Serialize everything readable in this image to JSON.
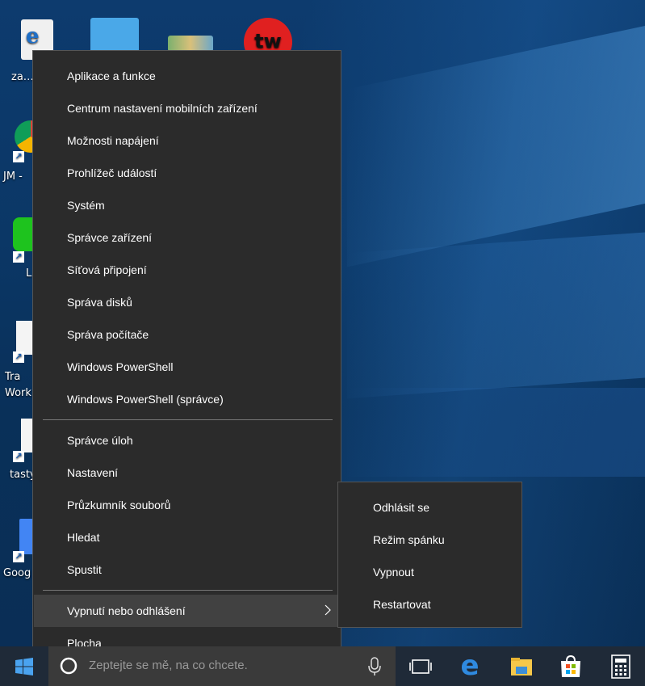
{
  "desktop": {
    "icons": [
      {
        "name": "doc-shortcut",
        "label": "za… stra…"
      },
      {
        "name": "chrome-shortcut",
        "label": "JM -"
      },
      {
        "name": "line-shortcut",
        "label": "L"
      },
      {
        "name": "pdf-shortcut",
        "label": "Tra Work"
      },
      {
        "name": "tasty-shortcut",
        "label": "tasty"
      },
      {
        "name": "google-docs-shortcut",
        "label": "Goog"
      }
    ]
  },
  "menu": {
    "items": [
      {
        "label": "Aplikace a funkce"
      },
      {
        "label": "Centrum nastavení mobilních zařízení"
      },
      {
        "label": "Možnosti napájení"
      },
      {
        "label": "Prohlížeč událostí"
      },
      {
        "label": "Systém"
      },
      {
        "label": "Správce zařízení"
      },
      {
        "label": "Síťová připojení"
      },
      {
        "label": "Správa disků"
      },
      {
        "label": "Správa počítače"
      },
      {
        "label": "Windows PowerShell"
      },
      {
        "label": "Windows PowerShell (správce)"
      },
      {
        "label": "Správce úloh"
      },
      {
        "label": "Nastavení"
      },
      {
        "label": "Průzkumník souborů"
      },
      {
        "label": "Hledat"
      },
      {
        "label": "Spustit"
      },
      {
        "label": "Vypnutí nebo odhlášení"
      },
      {
        "label": "Plocha"
      }
    ]
  },
  "submenu": {
    "items": [
      {
        "label": "Odhlásit se"
      },
      {
        "label": "Režim spánku"
      },
      {
        "label": "Vypnout"
      },
      {
        "label": "Restartovat"
      }
    ]
  },
  "taskbar": {
    "search_placeholder": "Zeptejte se mě, na co chcete.",
    "icons": [
      "windows-start-icon",
      "microphone-icon",
      "task-view-icon",
      "edge-icon",
      "file-explorer-icon",
      "store-icon",
      "calculator-icon"
    ]
  },
  "colors": {
    "menu_bg": "#2b2b2b",
    "menu_highlight": "#414141",
    "taskbar_bg": "#1f2a38",
    "desktop_bg": "#0b3766"
  }
}
